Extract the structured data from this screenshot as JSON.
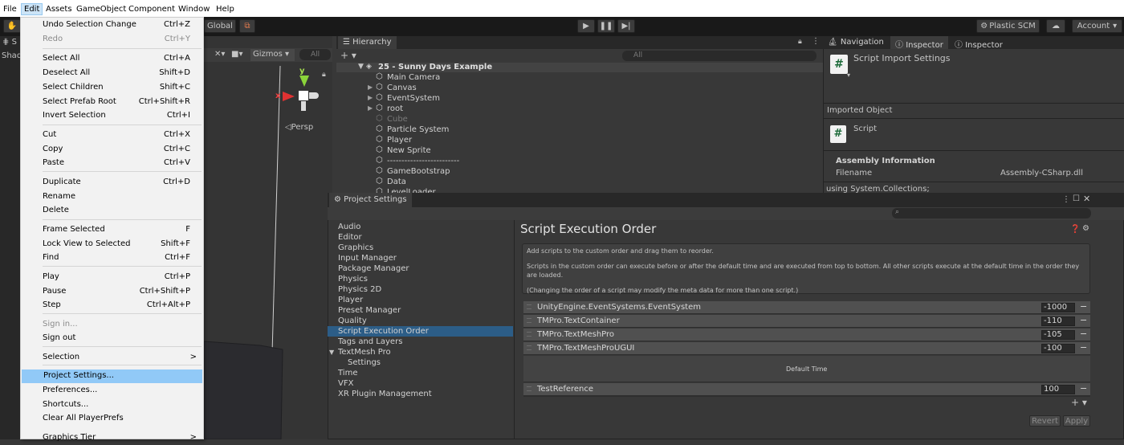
{
  "menubar": {
    "items": [
      "File",
      "Edit",
      "Assets",
      "GameObject",
      "Component",
      "Window",
      "Help"
    ]
  },
  "toolbar": {
    "global_label": "Global",
    "plastic_label": "Plastic SCM",
    "account_label": "Account"
  },
  "edit_menu": {
    "items": [
      {
        "label": "Undo Selection Change",
        "shortcut": "Ctrl+Z"
      },
      {
        "label": "Redo",
        "shortcut": "Ctrl+Y"
      },
      {
        "label": "Select All",
        "shortcut": "Ctrl+A"
      },
      {
        "label": "Deselect All",
        "shortcut": "Shift+D"
      },
      {
        "label": "Select Children",
        "shortcut": "Shift+C"
      },
      {
        "label": "Select Prefab Root",
        "shortcut": "Ctrl+Shift+R"
      },
      {
        "label": "Invert Selection",
        "shortcut": "Ctrl+I"
      },
      {
        "label": "Cut",
        "shortcut": "Ctrl+X"
      },
      {
        "label": "Copy",
        "shortcut": "Ctrl+C"
      },
      {
        "label": "Paste",
        "shortcut": "Ctrl+V"
      },
      {
        "label": "Duplicate",
        "shortcut": "Ctrl+D"
      },
      {
        "label": "Rename",
        "shortcut": ""
      },
      {
        "label": "Delete",
        "shortcut": ""
      },
      {
        "label": "Frame Selected",
        "shortcut": "F"
      },
      {
        "label": "Lock View to Selected",
        "shortcut": "Shift+F"
      },
      {
        "label": "Find",
        "shortcut": "Ctrl+F"
      },
      {
        "label": "Play",
        "shortcut": "Ctrl+P"
      },
      {
        "label": "Pause",
        "shortcut": "Ctrl+Shift+P"
      },
      {
        "label": "Step",
        "shortcut": "Ctrl+Alt+P"
      },
      {
        "label": "Sign in...",
        "shortcut": ""
      },
      {
        "label": "Sign out",
        "shortcut": ""
      },
      {
        "label": "Selection",
        "shortcut": ">"
      },
      {
        "label": "Project Settings...",
        "shortcut": ""
      },
      {
        "label": "Preferences...",
        "shortcut": ""
      },
      {
        "label": "Shortcuts...",
        "shortcut": ""
      },
      {
        "label": "Clear All PlayerPrefs",
        "shortcut": ""
      },
      {
        "label": "Graphics Tier",
        "shortcut": ">"
      }
    ]
  },
  "scene": {
    "gizmos_label": "Gizmos",
    "search_placeholder": "All",
    "persp_label": "Persp",
    "axis_y": "y",
    "axis_x": "x",
    "left_tab_s": "S",
    "left_shad": "Shad"
  },
  "hierarchy": {
    "tab_label": "Hierarchy",
    "search_placeholder": "All",
    "scene_name": "25 - Sunny Days Example",
    "items": [
      {
        "name": "Main Camera",
        "arrow": false,
        "dim": false
      },
      {
        "name": "Canvas",
        "arrow": true,
        "dim": false
      },
      {
        "name": "EventSystem",
        "arrow": true,
        "dim": false
      },
      {
        "name": "root",
        "arrow": true,
        "dim": false
      },
      {
        "name": "Cube",
        "arrow": false,
        "dim": true
      },
      {
        "name": "Particle System",
        "arrow": false,
        "dim": false
      },
      {
        "name": "Player",
        "arrow": false,
        "dim": false
      },
      {
        "name": "New Sprite",
        "arrow": false,
        "dim": false
      },
      {
        "name": "-------------------------",
        "arrow": false,
        "dim": false
      },
      {
        "name": "GameBootstrap",
        "arrow": false,
        "dim": false
      },
      {
        "name": "Data",
        "arrow": false,
        "dim": false
      },
      {
        "name": "LevelLoader",
        "arrow": false,
        "dim": false
      }
    ]
  },
  "inspector": {
    "tabs": [
      "Navigation",
      "Inspector",
      "Inspector"
    ],
    "title": "Script Import Settings",
    "imported_object": "Imported Object",
    "script_label": "Script",
    "assembly_header": "Assembly Information",
    "filename_label": "Filename",
    "filename_value": "Assembly-CSharp.dll",
    "code_preview": "using System.Collections;"
  },
  "project_settings": {
    "title": "Project Settings",
    "nav": [
      "Audio",
      "Editor",
      "Graphics",
      "Input Manager",
      "Package Manager",
      "Physics",
      "Physics 2D",
      "Player",
      "Preset Manager",
      "Quality",
      "Script Execution Order",
      "Tags and Layers",
      "TextMesh Pro",
      "Settings",
      "Time",
      "VFX",
      "XR Plugin Management"
    ],
    "heading": "Script Execution Order",
    "help_line1": "Add scripts to the custom order and drag them to reorder.",
    "help_line2": "Scripts in the custom order can execute before or after the default time and are executed from top to bottom. All other scripts execute at the default time in the order they are loaded.",
    "help_line3": "(Changing the order of a script may modify the meta data for more than one script.)",
    "rows": [
      {
        "name": "UnityEngine.EventSystems.EventSystem",
        "value": "-1000"
      },
      {
        "name": "TMPro.TextContainer",
        "value": "-110"
      },
      {
        "name": "TMPro.TextMeshPro",
        "value": "-105"
      },
      {
        "name": "TMPro.TextMeshProUGUI",
        "value": "-100"
      }
    ],
    "default_time": "Default Time",
    "after_rows": [
      {
        "name": "TestReference",
        "value": "100"
      }
    ],
    "minus": "−",
    "revert_label": "Revert",
    "apply_label": "Apply"
  },
  "colors": {
    "selection": "#2c5d87",
    "menu_highlight": "#91c9f7"
  }
}
